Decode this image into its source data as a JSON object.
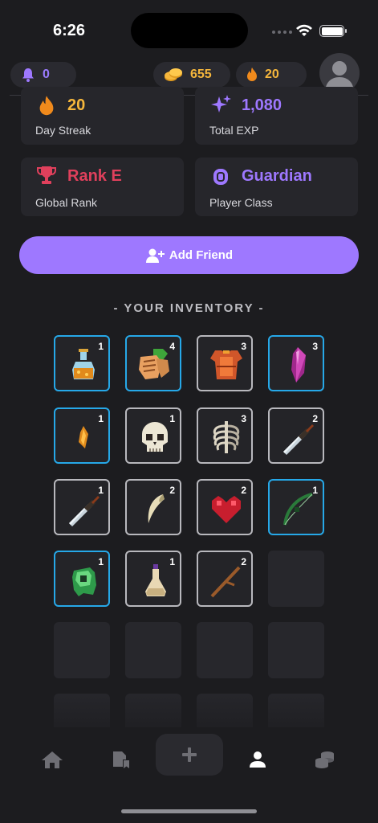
{
  "status": {
    "time": "6:26"
  },
  "topbar": {
    "notifications": "0",
    "coins": "655",
    "streak": "20"
  },
  "stats": [
    {
      "value": "20",
      "label": "Day Streak",
      "color": "#f6b73c",
      "icon": "flame-icon"
    },
    {
      "value": "1,080",
      "label": "Total EXP",
      "color": "#9e78ff",
      "icon": "sparkle-icon"
    },
    {
      "value": "Rank E",
      "label": "Global Rank",
      "color": "#e0405c",
      "icon": "trophy-icon"
    },
    {
      "value": "Guardian",
      "label": "Player Class",
      "color": "#9e78ff",
      "icon": "class-icon"
    }
  ],
  "add_friend": {
    "label": "Add Friend"
  },
  "inventory": {
    "title": "- YOUR INVENTORY -",
    "items": [
      {
        "name": "potion",
        "count": "1",
        "border": "blue"
      },
      {
        "name": "hands",
        "count": "4",
        "border": "blue"
      },
      {
        "name": "armor",
        "count": "3",
        "border": "gray"
      },
      {
        "name": "crystal",
        "count": "3",
        "border": "blue"
      },
      {
        "name": "feather",
        "count": "1",
        "border": "blue"
      },
      {
        "name": "skull",
        "count": "1",
        "border": "gray"
      },
      {
        "name": "ribcage",
        "count": "3",
        "border": "gray"
      },
      {
        "name": "dagger",
        "count": "2",
        "border": "gray"
      },
      {
        "name": "dagger",
        "count": "1",
        "border": "gray"
      },
      {
        "name": "fang",
        "count": "2",
        "border": "gray"
      },
      {
        "name": "heart",
        "count": "2",
        "border": "gray"
      },
      {
        "name": "bow",
        "count": "1",
        "border": "blue"
      },
      {
        "name": "slime",
        "count": "1",
        "border": "blue"
      },
      {
        "name": "flask",
        "count": "1",
        "border": "gray"
      },
      {
        "name": "stick",
        "count": "2",
        "border": "gray"
      }
    ]
  },
  "tabs": [
    "home",
    "quests",
    "add",
    "profile",
    "coins"
  ]
}
